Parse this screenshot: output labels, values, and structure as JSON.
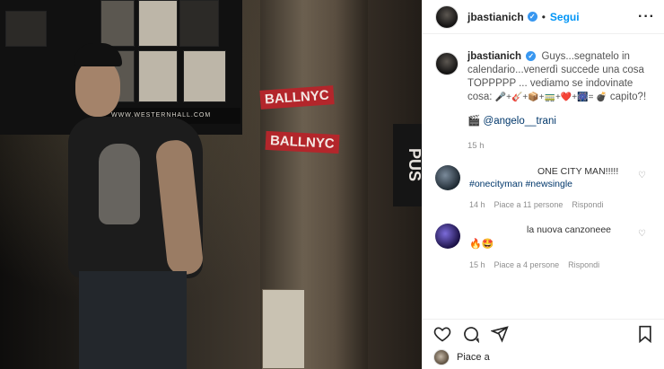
{
  "post": {
    "username": "jbastianich",
    "follow_label": "Segui",
    "dot": "•",
    "more_icon": "more-horizontal-icon"
  },
  "caption": {
    "username": "jbastianich",
    "text_1": "Guys...segnatelo in calendario...venerdì succede una cosa TOPPPPP ... vediamo se indovinate cosa: ",
    "text_2": " capito?!",
    "emoji_seq": "🎤+🎸+📦+🚃+❤️+🎆= 💣",
    "credit_icon": "🎬",
    "mention": "@angelo__trani",
    "time": "15 h"
  },
  "comments": [
    {
      "text_1": "ONE CITY MAN!!!!! ",
      "tag_1": "#onecityman",
      "tag_2": "#newsingle",
      "time": "14 h",
      "likes": "Piace a 11 persone",
      "reply": "Rispondi"
    },
    {
      "text": "la nuova canzoneee",
      "emoji": "🔥🤩",
      "time": "15 h",
      "likes": "Piace a 4 persone",
      "reply": "Rispondi"
    }
  ],
  "footer": {
    "likes_label": "Piace a"
  },
  "photo": {
    "sticker_1": "BALLNYC",
    "sticker_2": "BALLNYC",
    "sign_strip": "WWW.WESTERNHALL.COM",
    "black_sign": "PUS"
  },
  "colors": {
    "accent": "#0095f6",
    "verified": "#3897f0",
    "sticker_red": "#b3262b"
  }
}
